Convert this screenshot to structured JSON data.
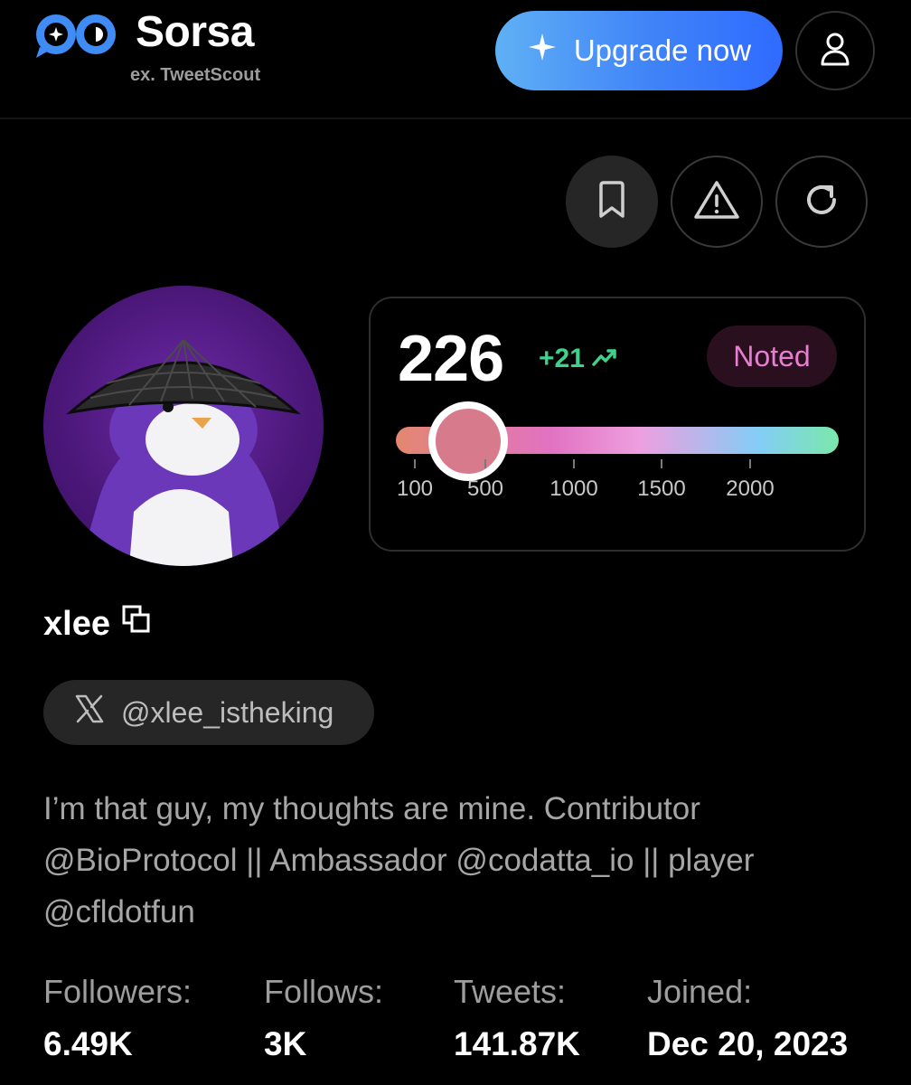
{
  "header": {
    "brand": "Sorsa",
    "subtitle": "ex. TweetScout",
    "upgrade_label": "Upgrade now"
  },
  "icons": {
    "logo": "sorsa-logo-icon",
    "upgrade": "sparkle-icon",
    "user": "user-icon",
    "bookmark": "bookmark-icon",
    "warning": "warning-icon",
    "refresh": "refresh-icon",
    "copy": "copy-icon",
    "x": "x-logo-icon",
    "trend": "trending-up-icon"
  },
  "score": {
    "value": "226",
    "delta": "+21",
    "badge": "Noted",
    "scale_ticks": [
      "100",
      "500",
      "1000",
      "1500",
      "2000"
    ]
  },
  "profile": {
    "name": "xlee",
    "handle": "@xlee_istheking",
    "bio": "I’m that guy, my thoughts are mine. Contributor @BioProtocol || Ambassador @codatta_io || player @cfldotfun"
  },
  "stats": [
    {
      "label": "Followers:",
      "value": "6.49K"
    },
    {
      "label": "Follows:",
      "value": "3K"
    },
    {
      "label": "Tweets:",
      "value": "141.87K"
    },
    {
      "label": "Joined:",
      "value": "Dec 20, 2023"
    }
  ],
  "colors": {
    "accent": "#3f83f8",
    "delta": "#3fd28a",
    "badge_text": "#e67fd0"
  }
}
